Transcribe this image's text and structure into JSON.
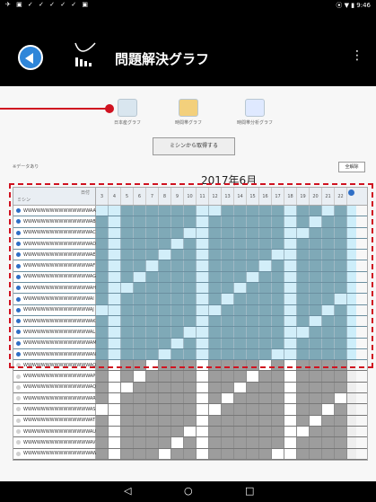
{
  "status": {
    "left_icons": "✈ ▣ ✓ ✓ ✓ ✓ ✓ ▣",
    "time": "⦿ ▼ ▮ 9:46"
  },
  "app": {
    "title": "問題解決グラフ",
    "menu": "⋮"
  },
  "graph_buttons": [
    {
      "label": "日本産グラフ"
    },
    {
      "label": "時間帯グラフ"
    },
    {
      "label": "時間帯分析グラフ"
    }
  ],
  "gather_button": "ミシンから取得する",
  "data_note": "※データあり",
  "release_button": "全解除",
  "month": "2017年6月",
  "grid": {
    "header_left_top": "日付",
    "header_left_bottom": "ミシン",
    "days": [
      "3",
      "4",
      "5",
      "6",
      "7",
      "8",
      "9",
      "10",
      "11",
      "12",
      "13",
      "14",
      "15",
      "16",
      "17",
      "18",
      "19",
      "20",
      "21",
      "22"
    ],
    "rows": [
      {
        "name": "WWWWWWWWWWWWWWWAA",
        "state": "on",
        "pattern": "vvvvvvvvvvvvvvvvvvvv"
      },
      {
        "name": "WWWWWWWWWWWWWWWAB",
        "state": "on",
        "pattern": "vvvvvvvvvvvvvvvvvvvv"
      },
      {
        "name": "WWWWWWWWWWWWWWWAC",
        "state": "on",
        "pattern": "vvvvvvvvvvvvvvvvvvvv"
      },
      {
        "name": "WWWWWWWWWWWWWWWAD",
        "state": "on",
        "pattern": "vvvvvvvvvvvvvvvvvvvv"
      },
      {
        "name": "WWWWWWWWWWWWWWWAE",
        "state": "on",
        "pattern": "vvvvvvvvvvvvvvvvvvvv"
      },
      {
        "name": "WWWWWWWWWWWWWWWAF",
        "state": "on",
        "pattern": "vvvvvvvvvvvvvvvvvvvv"
      },
      {
        "name": "WWWWWWWWWWWWWWWAG",
        "state": "on",
        "pattern": "vvvvvvvvvvvvvvvvvvvv"
      },
      {
        "name": "WWWWWWWWWWWWWWWAH",
        "state": "on",
        "pattern": "vvvvvvvvvvvvvvvvvvvv"
      },
      {
        "name": "WWWWWWWWWWWWWWWAI",
        "state": "on",
        "pattern": "vvvvvvvvvvvvvvvvvvvv"
      },
      {
        "name": "WWWWWWWWWWWWWWWAJ",
        "state": "on",
        "pattern": "vvvvvvvvvvvvvvvvvvvv"
      },
      {
        "name": "WWWWWWWWWWWWWWWAK",
        "state": "on",
        "pattern": "vvvvvvvvvvvvvvvvvvvv"
      },
      {
        "name": "WWWWWWWWWWWWWWWAL",
        "state": "on",
        "pattern": "vvvvvvvvvvvvvvvvvvvv"
      },
      {
        "name": "WWWWWWWWWWWWWWWAM",
        "state": "on",
        "pattern": "vvvvvvvvvvvvvvvvvvvv"
      },
      {
        "name": "WWWWWWWWWWWWWWWAN",
        "state": "on",
        "pattern": "vvvvvvvvvvvvvvvvvvvv"
      },
      {
        "name": "WWWWWWWWWWWWWWWAO",
        "state": "off",
        "pattern": "vvvvvvvvvvvvvvvvvvvv"
      },
      {
        "name": "WWWWWWWWWWWWWWWAP",
        "state": "off",
        "pattern": "vvvvvvvvvvvvvvvvvvvv"
      },
      {
        "name": "WWWWWWWWWWWWWWWAQ",
        "state": "off",
        "pattern": "vvvvvvvvvvvvvvvvvvvv"
      },
      {
        "name": "WWWWWWWWWWWWWWWAR",
        "state": "off",
        "pattern": "vvvvvvvvvvvvvvvvvvvv"
      },
      {
        "name": "WWWWWWWWWWWWWWWAS",
        "state": "off",
        "pattern": "vvvvvvvvvvvvvvvvvvvv"
      },
      {
        "name": "WWWWWWWWWWWWWWWAT",
        "state": "off",
        "pattern": "vvvvvvvvvvvvvvvvvvvv"
      },
      {
        "name": "WWWWWWWWWWWWWWWAU",
        "state": "off",
        "pattern": "vvvvvvvvvvvvvvvvvvvv"
      },
      {
        "name": "WWWWWWWWWWWWWWWAV",
        "state": "off",
        "pattern": "vvvvvvvvvvvvvvvvvvvv"
      },
      {
        "name": "WWWWWWWWWWWWWWWAW",
        "state": "off",
        "pattern": "vvvvvvvvvvvvvvvvvvvv"
      }
    ]
  },
  "nav": {
    "back": "◁",
    "home": "○",
    "recent": "□"
  }
}
